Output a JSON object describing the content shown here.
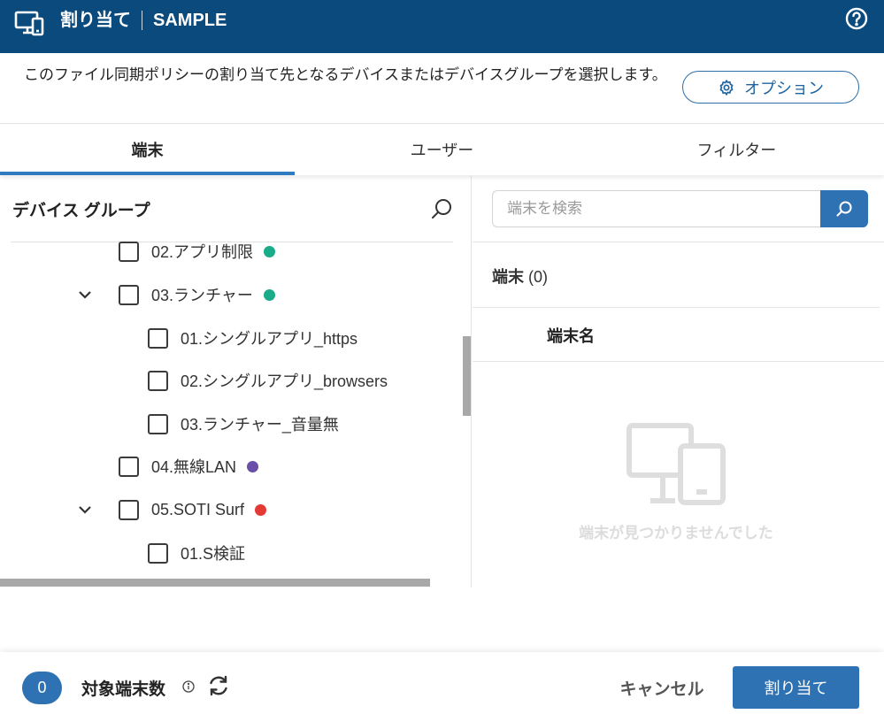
{
  "header": {
    "title": "割り当て",
    "subtitle": "SAMPLE"
  },
  "description": "このファイル同期ポリシーの割り当て先となるデバイスまたはデバイスグループを選択します。",
  "options_button": "オプション",
  "tabs": [
    {
      "label": "端末",
      "active": true
    },
    {
      "label": "ユーザー",
      "active": false
    },
    {
      "label": "フィルター",
      "active": false
    }
  ],
  "left_panel": {
    "title": "デバイス グループ",
    "tree": [
      {
        "label": "02.アプリ制限",
        "level": 1,
        "expanded": null,
        "dot_color": "#1aab8a"
      },
      {
        "label": "03.ランチャー",
        "level": 1,
        "expanded": true,
        "dot_color": "#1aab8a"
      },
      {
        "label": "01.シングルアプリ_https",
        "level": 2,
        "expanded": null,
        "dot_color": null
      },
      {
        "label": "02.シングルアプリ_browsers",
        "level": 2,
        "expanded": null,
        "dot_color": null
      },
      {
        "label": "03.ランチャー_音量無",
        "level": 2,
        "expanded": null,
        "dot_color": null
      },
      {
        "label": "04.無線LAN",
        "level": 1,
        "expanded": null,
        "dot_color": "#6a4fa8"
      },
      {
        "label": "05.SOTI Surf",
        "level": 1,
        "expanded": true,
        "dot_color": "#e53935"
      },
      {
        "label": "01.S検証",
        "level": 2,
        "expanded": null,
        "dot_color": null
      }
    ]
  },
  "right_panel": {
    "search_placeholder": "端末を検索",
    "count_label": "端末",
    "count_value": "(0)",
    "column_header": "端末名",
    "empty_text": "端末が見つかりませんでした"
  },
  "footer": {
    "count": "0",
    "count_label": "対象端末数",
    "cancel": "キャンセル",
    "assign": "割り当て"
  },
  "colors": {
    "header_bg": "#0b4a7d",
    "accent": "#2f72b3"
  }
}
